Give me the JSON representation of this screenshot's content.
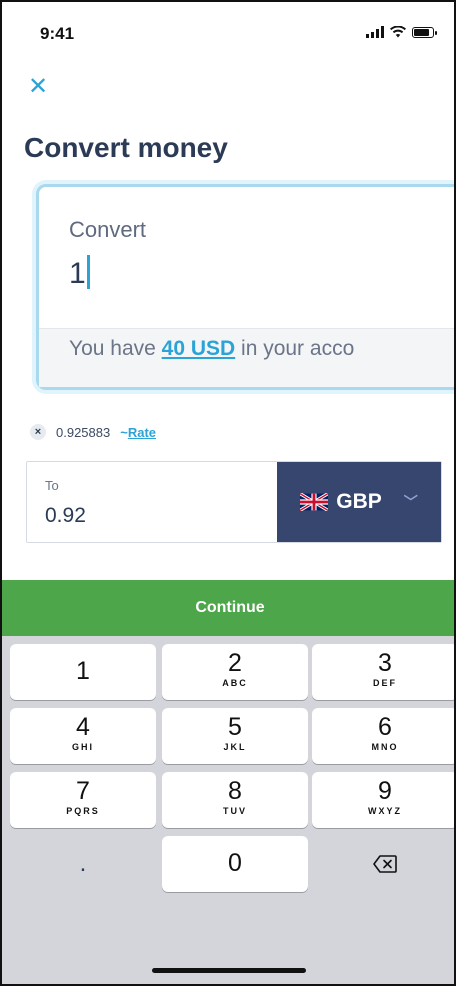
{
  "status_bar": {
    "time": "9:41"
  },
  "header": {
    "close_icon": "close-icon",
    "title": "Convert money"
  },
  "convert_card": {
    "label": "Convert",
    "value": "1",
    "balance_prefix": "You have ",
    "balance_link": "40 USD",
    "balance_suffix": " in your acco"
  },
  "rate": {
    "value": "0.925883",
    "tilde": "~",
    "link": "Rate"
  },
  "to_field": {
    "label": "To",
    "value": "0.92",
    "currency": "GBP",
    "flag_icon": "uk-flag-icon"
  },
  "continue_label": "Continue",
  "keypad": {
    "keys": [
      {
        "num": "1",
        "letters": ""
      },
      {
        "num": "2",
        "letters": "ABC"
      },
      {
        "num": "3",
        "letters": "DEF"
      },
      {
        "num": "4",
        "letters": "GHI"
      },
      {
        "num": "5",
        "letters": "JKL"
      },
      {
        "num": "6",
        "letters": "MNO"
      },
      {
        "num": "7",
        "letters": "PQRS"
      },
      {
        "num": "8",
        "letters": "TUV"
      },
      {
        "num": "9",
        "letters": "WXYZ"
      }
    ],
    "dot": ".",
    "zero": "0",
    "backspace_icon": "backspace-icon"
  },
  "colors": {
    "accent": "#2ba3d6",
    "continue": "#4ea64a",
    "currency_button": "#37466f",
    "title": "#2b3a55"
  }
}
